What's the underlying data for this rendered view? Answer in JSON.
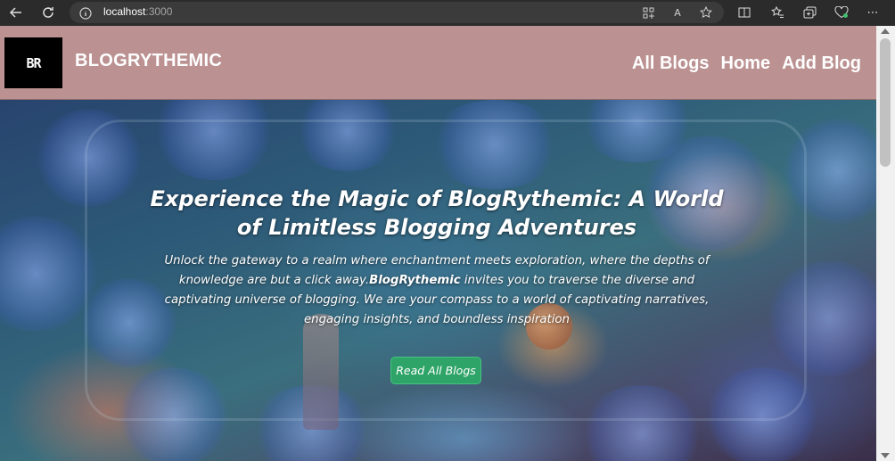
{
  "browser": {
    "url_host": "localhost",
    "url_port": ":3000",
    "icons": {
      "back": "arrow-left-icon",
      "refresh": "refresh-icon",
      "info": "info-icon",
      "apps": "apps-grid-icon",
      "read_aloud": "read-aloud-icon",
      "favorite": "star-icon",
      "split": "split-screen-icon",
      "favorites": "favorites-list-icon",
      "collections": "collections-icon",
      "heart": "browser-essentials-icon",
      "more": "more-icon"
    },
    "read_aloud_label": "A",
    "more_label": "⋯"
  },
  "site": {
    "logo_text": "BR",
    "brand": "BLOGRYTHEMIC",
    "nav": [
      {
        "label": "All Blogs"
      },
      {
        "label": "Home"
      },
      {
        "label": "Add Blog"
      }
    ],
    "header_color": "#bb9191"
  },
  "hero": {
    "title": "Experience the Magic of BlogRythemic: A World of Limitless Blogging Adventures",
    "text_before": "Unlock the gateway to a realm where enchantment meets exploration, where the depths of knowledge are but a click away.",
    "text_bold": "BlogRythemic",
    "text_after": " invites you to traverse the diverse and captivating universe of blogging. We are your compass to a world of captivating narratives, engaging insights, and boundless inspiration",
    "cta_label": "Read All Blogs",
    "cta_color": "#2fa468"
  }
}
